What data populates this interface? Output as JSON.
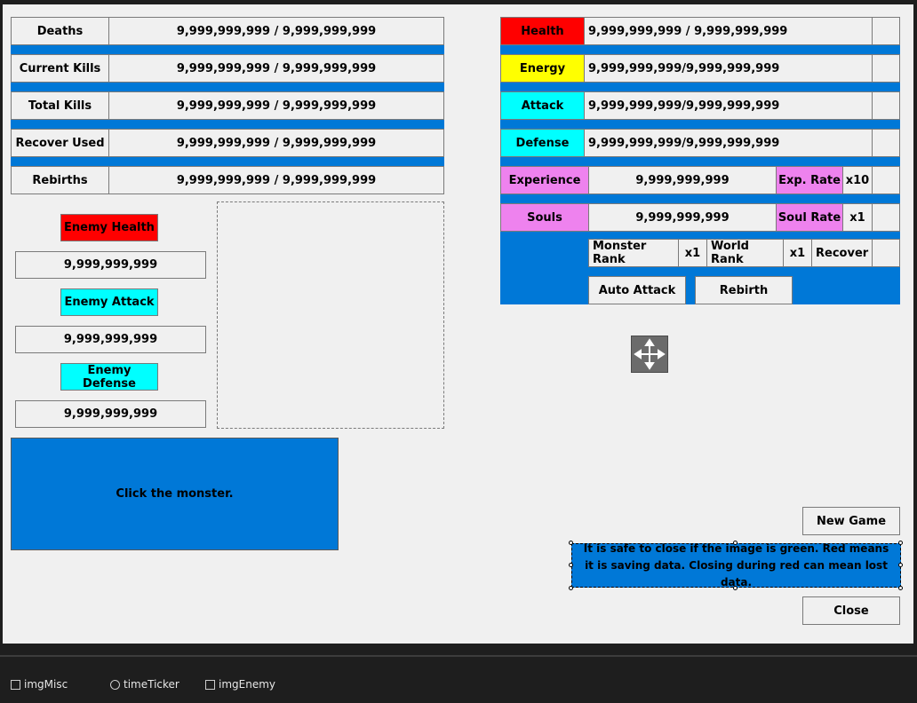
{
  "stats_left": [
    {
      "label": "Deaths",
      "value": "9,999,999,999 / 9,999,999,999"
    },
    {
      "label": "Current Kills",
      "value": "9,999,999,999 / 9,999,999,999"
    },
    {
      "label": "Total Kills",
      "value": "9,999,999,999 / 9,999,999,999"
    },
    {
      "label": "Recover Used",
      "value": "9,999,999,999 / 9,999,999,999"
    },
    {
      "label": "Rebirths",
      "value": "9,999,999,999 / 9,999,999,999"
    }
  ],
  "enemy": {
    "health_label": "Enemy Health",
    "health_value": "9,999,999,999",
    "attack_label": "Enemy Attack",
    "attack_value": "9,999,999,999",
    "defense_label": "Enemy Defense",
    "defense_value": "9,999,999,999"
  },
  "monster_prompt": "Click the monster.",
  "player": {
    "health_label": "Health",
    "health_value": "9,999,999,999 / 9,999,999,999",
    "energy_label": "Energy",
    "energy_value": "9,999,999,999/9,999,999,999",
    "attack_label": "Attack",
    "attack_value": "9,999,999,999/9,999,999,999",
    "defense_label": "Defense",
    "defense_value": "9,999,999,999/9,999,999,999",
    "experience_label": "Experience",
    "experience_value": "9,999,999,999",
    "exp_rate_label": "Exp. Rate",
    "exp_rate_value": "x10",
    "souls_label": "Souls",
    "souls_value": "9,999,999,999",
    "soul_rate_label": "Soul Rate",
    "soul_rate_value": "x1"
  },
  "ranks": {
    "monster_rank_label": "Monster Rank",
    "monster_rank_value": "x1",
    "world_rank_label": "World Rank",
    "world_rank_value": "x1",
    "recover_label": "Recover"
  },
  "buttons": {
    "auto_attack": "Auto Attack",
    "rebirth": "Rebirth",
    "new_game": "New Game",
    "close": "Close"
  },
  "save_notice": "It is safe to close if the image is green. Red means it is saving data. Closing during red can mean lost data.",
  "tray": [
    "imgMisc",
    "timeTicker",
    "imgEnemy"
  ],
  "colors": {
    "accent_blue": "#0078d7",
    "health_red": "#ff0000",
    "energy_yellow": "#ffff00",
    "stat_cyan": "#00ffff",
    "soul_violet": "#ee82ee"
  }
}
